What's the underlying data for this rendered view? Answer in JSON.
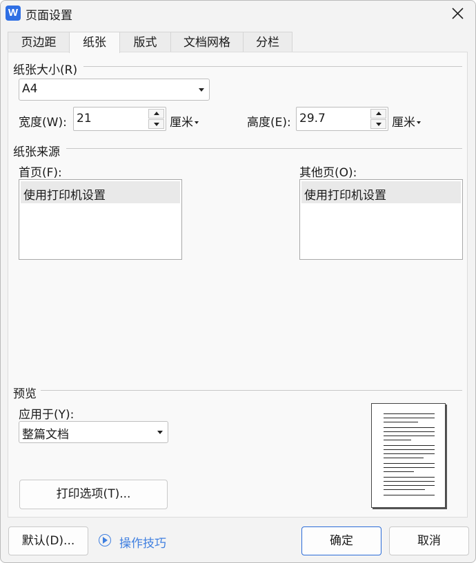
{
  "window": {
    "title": "页面设置",
    "app_icon_letter": "W"
  },
  "tabs": [
    {
      "label": "页边距",
      "active": false
    },
    {
      "label": "纸张",
      "active": true
    },
    {
      "label": "版式",
      "active": false
    },
    {
      "label": "文档网格",
      "active": false
    },
    {
      "label": "分栏",
      "active": false
    }
  ],
  "paper_size": {
    "group_title": "纸张大小(R)",
    "selected": "A4",
    "width_label": "宽度(W):",
    "width_value": "21",
    "width_unit": "厘米",
    "height_label": "高度(E):",
    "height_value": "29.7",
    "height_unit": "厘米"
  },
  "paper_source": {
    "group_title": "纸张来源",
    "first_page_label": "首页(F):",
    "first_page_items": [
      "使用打印机设置"
    ],
    "other_pages_label": "其他页(O):",
    "other_pages_items": [
      "使用打印机设置"
    ]
  },
  "preview": {
    "group_title": "预览",
    "apply_to_label": "应用于(Y):",
    "apply_to_value": "整篇文档",
    "print_options_label": "打印选项(T)..."
  },
  "footer": {
    "default_label": "默认(D)...",
    "tips_label": "操作技巧",
    "ok_label": "确定",
    "cancel_label": "取消"
  },
  "colors": {
    "accent": "#2a6bd8",
    "link": "#3f7fe0",
    "app_icon": "#2f6fe4"
  }
}
